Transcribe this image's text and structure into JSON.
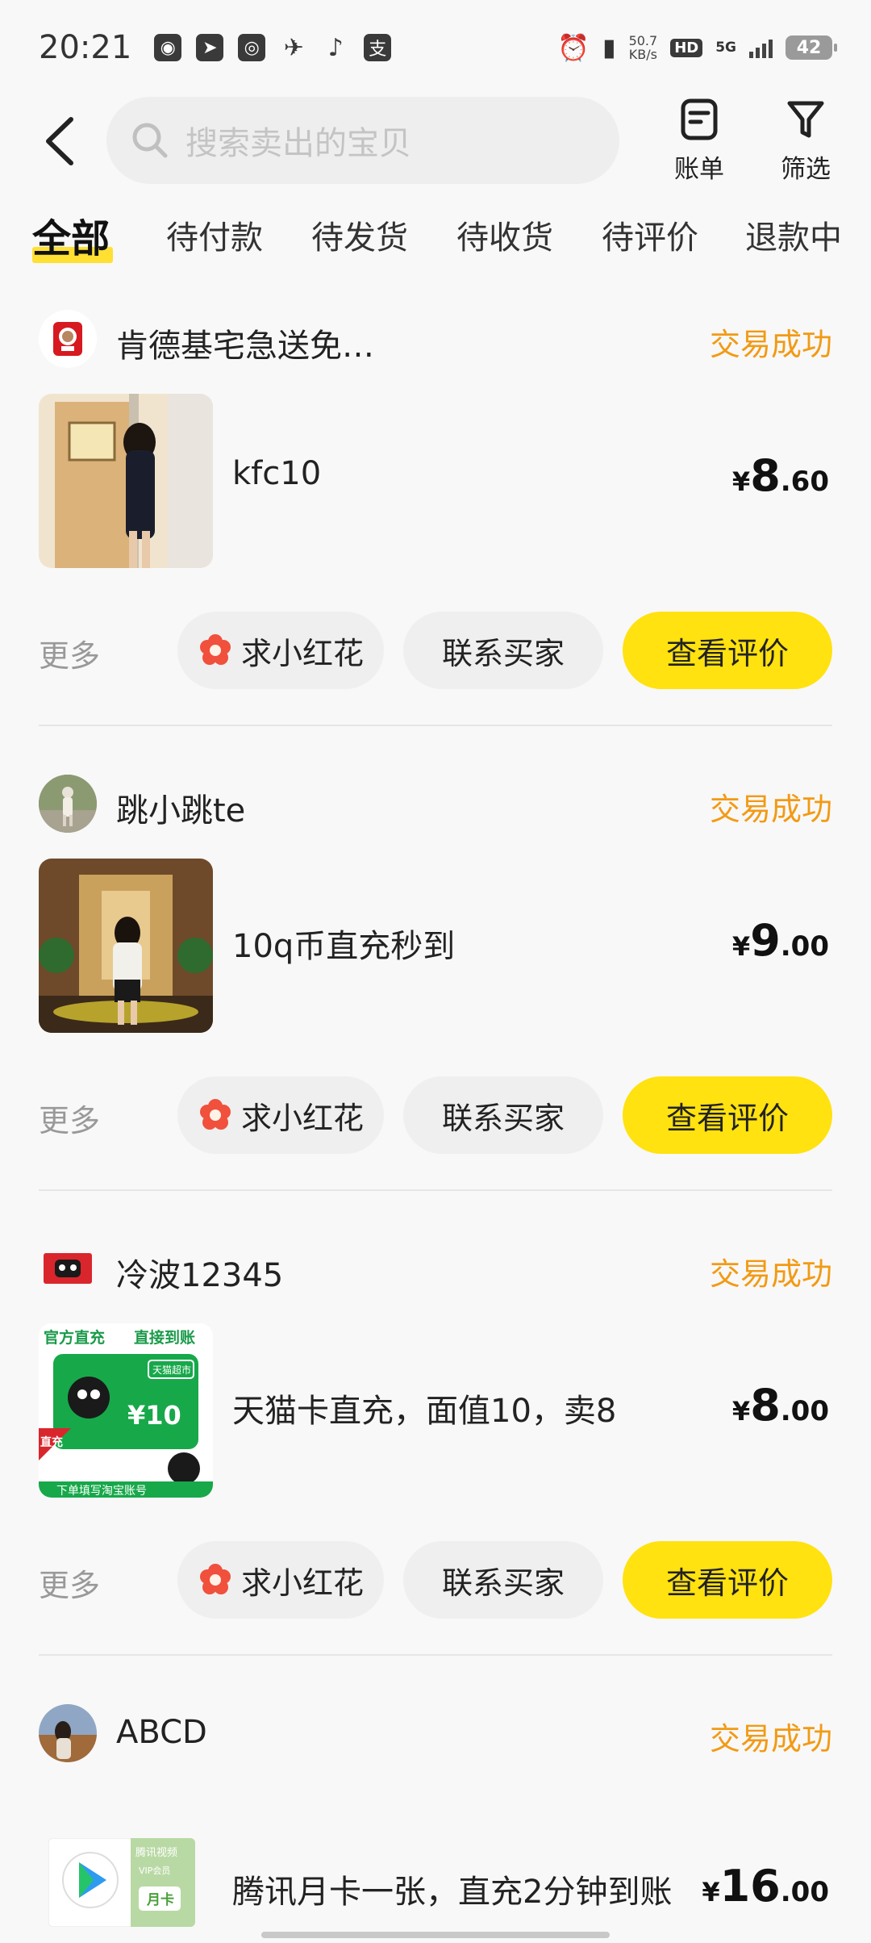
{
  "status_bar": {
    "time": "20:21",
    "net_speed_value": "50.7",
    "net_speed_unit": "KB/s",
    "hd": "HD",
    "network": "5G",
    "battery": "42"
  },
  "search": {
    "placeholder": "搜索卖出的宝贝"
  },
  "top_actions": {
    "bill_label": "账单",
    "filter_label": "筛选"
  },
  "tabs": [
    {
      "label": "全部"
    },
    {
      "label": "待付款"
    },
    {
      "label": "待发货"
    },
    {
      "label": "待收货"
    },
    {
      "label": "待评价"
    },
    {
      "label": "退款中"
    }
  ],
  "orders": [
    {
      "shop_name": "肯德基宅急送免…",
      "status": "交易成功",
      "item_title": "kfc10",
      "price": {
        "currency": "¥",
        "int": "8",
        "dec": ".60"
      },
      "more": "更多",
      "btn_flower": "求小红花",
      "btn_contact": "联系买家",
      "btn_review": "查看评价"
    },
    {
      "shop_name": "跳小跳te",
      "status": "交易成功",
      "item_title": "10q币直充秒到",
      "price": {
        "currency": "¥",
        "int": "9",
        "dec": ".00"
      },
      "more": "更多",
      "btn_flower": "求小红花",
      "btn_contact": "联系买家",
      "btn_review": "查看评价"
    },
    {
      "shop_name": "冷波12345",
      "status": "交易成功",
      "item_title": "天猫卡直充，面值10，卖8",
      "price": {
        "currency": "¥",
        "int": "8",
        "dec": ".00"
      },
      "thumb_text": {
        "top_left": "官方直充",
        "top_right": "直接到账",
        "badge": "天猫超市",
        "amount": "¥10",
        "corner": "直充",
        "bottom": "下单填写淘宝账号"
      },
      "more": "更多",
      "btn_flower": "求小红花",
      "btn_contact": "联系买家",
      "btn_review": "查看评价"
    },
    {
      "shop_name": "ABCD",
      "status": "交易成功",
      "item_title": "腾讯月卡一张，直充2分钟到账",
      "price": {
        "currency": "¥",
        "int": "16",
        "dec": ".00"
      },
      "thumb_text": {
        "brand": "腾讯视频",
        "vip": "VIP会员",
        "card": "月卡"
      }
    }
  ],
  "colors": {
    "accent_yellow": "#ffe20f",
    "status_orange": "#f29a14",
    "background": "#f8f8f8"
  }
}
